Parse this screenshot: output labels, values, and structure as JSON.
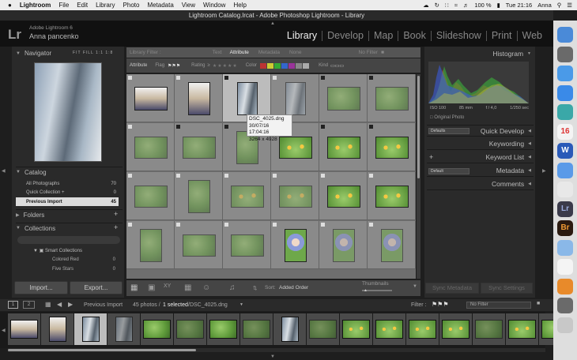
{
  "menubar": {
    "apple": "",
    "app": "Lightroom",
    "items": [
      "File",
      "Edit",
      "Library",
      "Photo",
      "Metadata",
      "View",
      "Window",
      "Help"
    ],
    "battery": "100 %",
    "clock": "Tue 21:16",
    "user": "Anna"
  },
  "window_title": "Lightroom Catalog.lrcat - Adobe Photoshop Lightroom - Library",
  "identity": {
    "logo": "Lr",
    "product": "Adobe Lightroom 6",
    "name": "Anna pancenko"
  },
  "modules": [
    "Library",
    "Develop",
    "Map",
    "Book",
    "Slideshow",
    "Print",
    "Web"
  ],
  "navigator": {
    "title": "Navigator",
    "zoom": [
      "FIT",
      "FILL",
      "1:1",
      "1:8"
    ]
  },
  "catalog": {
    "title": "Catalog",
    "items": [
      {
        "label": "All Photographs",
        "count": "70"
      },
      {
        "label": "Quick Collection +",
        "count": "0"
      },
      {
        "label": "Previous Import",
        "count": "45"
      }
    ]
  },
  "folders": {
    "title": "Folders",
    "add": "+"
  },
  "collections": {
    "title": "Collections",
    "add": "+",
    "smart": "Smart Collections",
    "items": [
      {
        "label": "Colored Red",
        "count": "0"
      },
      {
        "label": "Five Stars",
        "count": "0"
      }
    ]
  },
  "buttons": {
    "import": "Import...",
    "export": "Export..."
  },
  "library_filter": {
    "label": "Library Filter :",
    "tabs": [
      "Text",
      "Attribute",
      "Metadata",
      "None"
    ],
    "preset": "No Filter"
  },
  "attribute_bar": {
    "attribute": "Attribute",
    "flag": "Flag",
    "rating": "Rating",
    "rating_op": "≥",
    "color": "Color",
    "kind": "Kind"
  },
  "tooltip": {
    "file": "DSC_4025.dng",
    "date": "30/07/16 17:04:16",
    "dims": "3264 x 4928"
  },
  "toolbar": {
    "sort_label": "Sort:",
    "sort_value": "Added Order",
    "thumbs": "Thumbnails"
  },
  "histogram": {
    "title": "Histogram",
    "iso": "ISO 100",
    "focal": "85 mm",
    "aperture": "f / 4,0",
    "shutter": "1/250 sec",
    "original": "Original Photo",
    "colors": {
      "red": "#d23a2a",
      "green": "#3ab03a",
      "blue": "#3a5ad8",
      "yellow": "#c8c83a"
    }
  },
  "right_panels": {
    "quick_develop": "Quick Develop",
    "qd_preset": "Defaults",
    "keywording": "Keywording",
    "keyword_list": "Keyword List",
    "metadata": "Metadata",
    "md_preset": "Default",
    "comments": "Comments"
  },
  "sync": {
    "metadata": "Sync Metadata",
    "settings": "Sync Settings"
  },
  "filmbar": {
    "view1": "1",
    "view2": "2",
    "source": "Previous Import",
    "count": "45 photos /",
    "selected": "1 selected",
    "file": "/DSC_4025.dng",
    "filter_label": "Filter :",
    "filter_value": "No Filter"
  },
  "dock_icons": [
    "finder-icon",
    "launchpad-icon",
    "rocket-icon",
    "safari-icon",
    "photos-app-icon",
    "calendar-icon",
    "word-icon",
    "safari-compass-icon",
    "chrome-icon",
    "lightroom-icon",
    "bridge-icon",
    "preview-icon",
    "photos-icon",
    "books-icon",
    "downloads-icon",
    "trash-icon"
  ],
  "dock_labels": {
    "calendar": "16",
    "lightroom": "Lr",
    "bridge": "Br",
    "word": "W"
  }
}
